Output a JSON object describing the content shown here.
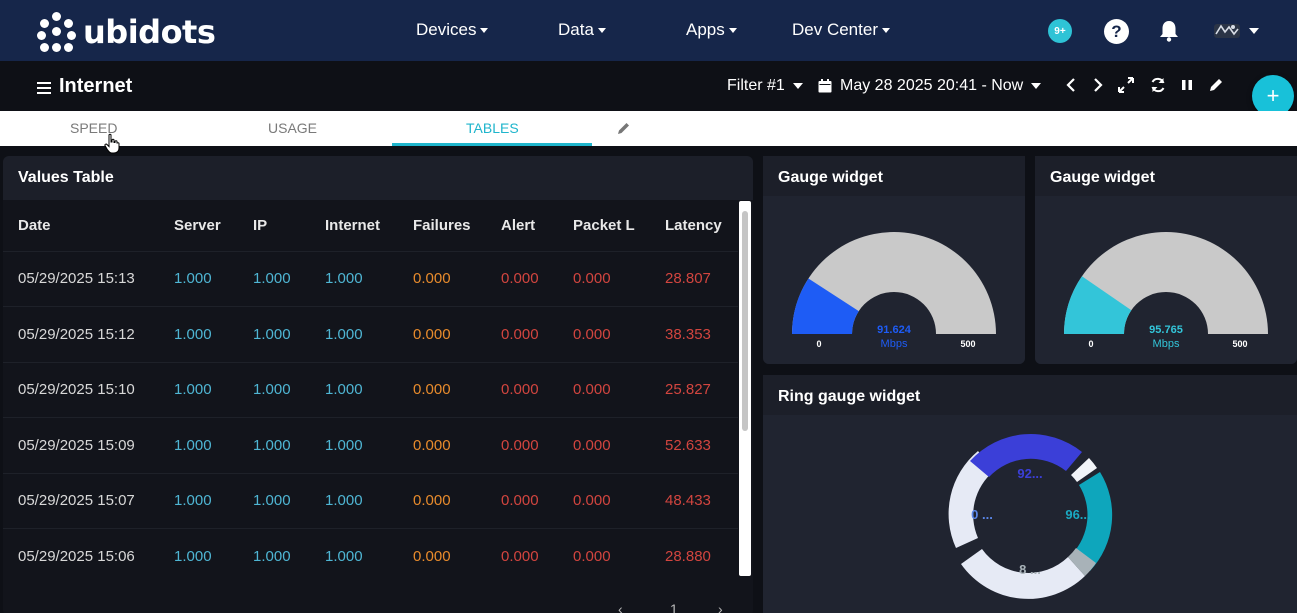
{
  "brand": {
    "name": "ubidots"
  },
  "nav": {
    "items": [
      "Devices",
      "Data",
      "Apps",
      "Dev Center"
    ],
    "notifications_badge": "9+",
    "help_label": "?"
  },
  "dashboard": {
    "title": "Internet",
    "filter_label": "Filter #1",
    "date_range": "May 28 2025 20:41 - Now",
    "fab_label": "+"
  },
  "tabs": [
    {
      "label": "SPEED",
      "active": false
    },
    {
      "label": "USAGE",
      "active": false
    },
    {
      "label": "TABLES",
      "active": true
    }
  ],
  "values_table": {
    "title": "Values Table",
    "columns": [
      "Date",
      "Server",
      "IP",
      "Internet",
      "Failures",
      "Alert",
      "Packet L",
      "Latency"
    ],
    "rows": [
      [
        "05/29/2025 15:13",
        "1.000",
        "1.000",
        "1.000",
        "0.000",
        "0.000",
        "0.000",
        "28.807"
      ],
      [
        "05/29/2025 15:12",
        "1.000",
        "1.000",
        "1.000",
        "0.000",
        "0.000",
        "0.000",
        "38.353"
      ],
      [
        "05/29/2025 15:10",
        "1.000",
        "1.000",
        "1.000",
        "0.000",
        "0.000",
        "0.000",
        "25.827"
      ],
      [
        "05/29/2025 15:09",
        "1.000",
        "1.000",
        "1.000",
        "0.000",
        "0.000",
        "0.000",
        "52.633"
      ],
      [
        "05/29/2025 15:07",
        "1.000",
        "1.000",
        "1.000",
        "0.000",
        "0.000",
        "0.000",
        "48.433"
      ],
      [
        "05/29/2025 15:06",
        "1.000",
        "1.000",
        "1.000",
        "0.000",
        "0.000",
        "0.000",
        "28.880"
      ]
    ],
    "page": "1"
  },
  "gauges": [
    {
      "title": "Gauge widget",
      "value": 91.624,
      "value_label": "91.624",
      "unit": "Mbps",
      "min": "0",
      "max": "500",
      "color": "#1e5cf5"
    },
    {
      "title": "Gauge widget",
      "value": 95.765,
      "value_label": "95.765",
      "unit": "Mbps",
      "min": "0",
      "max": "500",
      "color": "#33c5d9"
    }
  ],
  "ring_gauge": {
    "title": "Ring gauge widget",
    "labels": [
      {
        "text": "92...",
        "color": "#3b3fd8"
      },
      {
        "text": "96...",
        "color": "#1aa9c2"
      },
      {
        "text": "8 ...",
        "color": "#a8b2b8"
      },
      {
        "text": "0 ...",
        "color": "#5a86e8"
      }
    ]
  },
  "colors": {
    "nav_bg": "#16264a",
    "accent": "#1fb5cc",
    "value_blue": "#4fb6d4",
    "value_orange": "#e88b2c",
    "value_red": "#d2453f"
  }
}
